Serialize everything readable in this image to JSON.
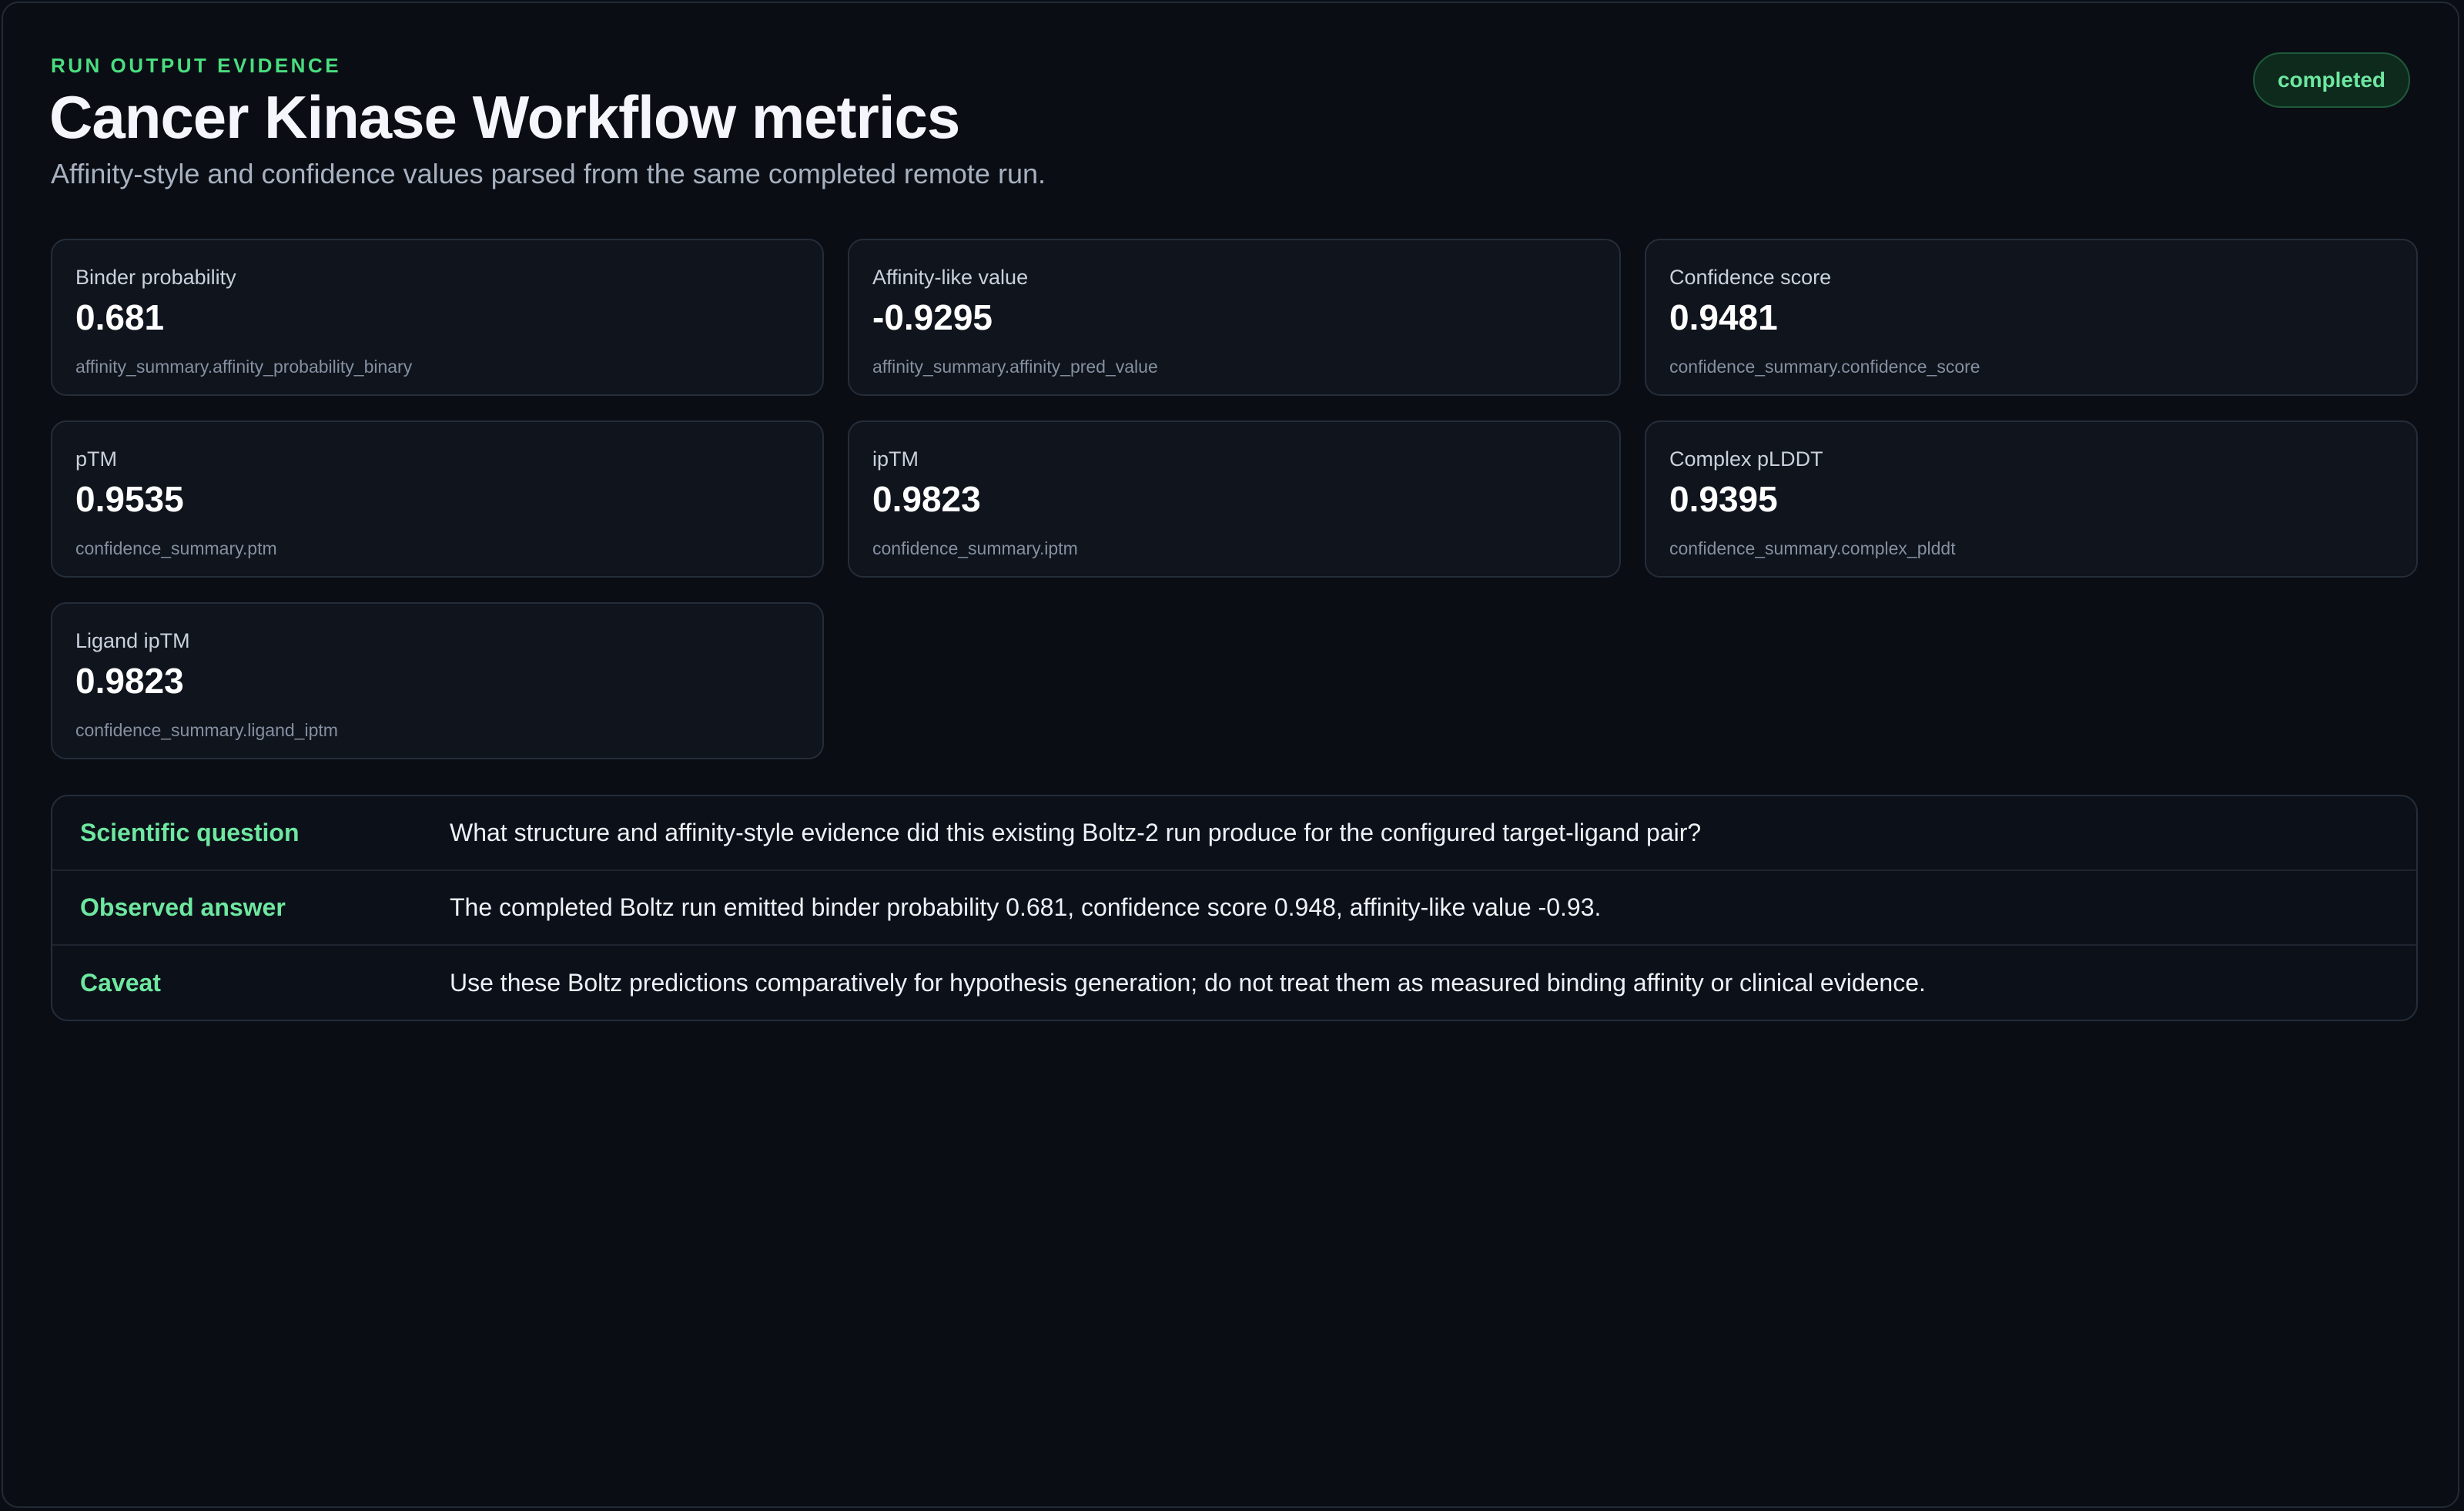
{
  "header": {
    "eyebrow": "RUN OUTPUT EVIDENCE",
    "title": "Cancer Kinase Workflow metrics",
    "subtitle": "Affinity-style and confidence values parsed from the same completed remote run.",
    "status": "completed"
  },
  "metrics": [
    {
      "label": "Binder probability",
      "value": "0.681",
      "key": "affinity_summary.affinity_probability_binary"
    },
    {
      "label": "Affinity-like value",
      "value": "-0.9295",
      "key": "affinity_summary.affinity_pred_value"
    },
    {
      "label": "Confidence score",
      "value": "0.9481",
      "key": "confidence_summary.confidence_score"
    },
    {
      "label": "pTM",
      "value": "0.9535",
      "key": "confidence_summary.ptm"
    },
    {
      "label": "ipTM",
      "value": "0.9823",
      "key": "confidence_summary.iptm"
    },
    {
      "label": "Complex pLDDT",
      "value": "0.9395",
      "key": "confidence_summary.complex_plddt"
    },
    {
      "label": "Ligand ipTM",
      "value": "0.9823",
      "key": "confidence_summary.ligand_iptm"
    }
  ],
  "qa": [
    {
      "key": "Scientific question",
      "value": "What structure and affinity-style evidence did this existing Boltz-2 run produce for the configured target-ligand pair?"
    },
    {
      "key": "Observed answer",
      "value": "The completed Boltz run emitted binder probability 0.681, confidence score 0.948, affinity-like value -0.93."
    },
    {
      "key": "Caveat",
      "value": "Use these Boltz predictions comparatively for hypothesis generation; do not treat them as measured binding affinity or clinical evidence."
    }
  ],
  "colors": {
    "accent": "#4ade80",
    "background": "#0a0e14",
    "card": "#0f141d",
    "badge_bg": "#0d2a1d"
  }
}
